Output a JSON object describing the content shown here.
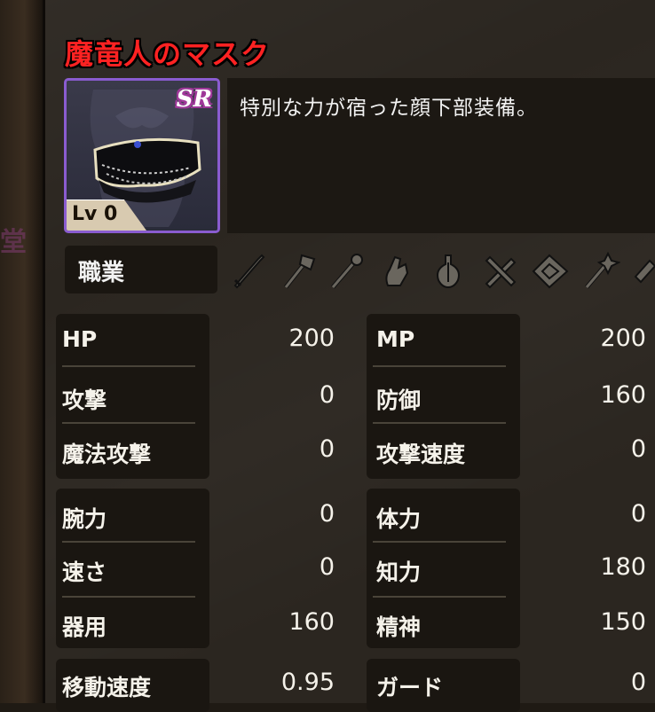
{
  "item": {
    "name": "魔竜人のマスク",
    "rarity": "SR",
    "level": "Lv 0",
    "description": "特別な力が宿った顔下部装備。"
  },
  "job": {
    "label": "職業",
    "icons": [
      "sword-icon",
      "axe-icon",
      "staff-icon",
      "fist-icon",
      "flask-icon",
      "crossed-daggers-icon",
      "book-icon",
      "wand-icon",
      "partial-icon"
    ]
  },
  "stats": {
    "group1": {
      "left": [
        {
          "label": "HP",
          "value": "200"
        },
        {
          "label": "攻撃",
          "value": "0"
        },
        {
          "label": "魔法攻撃",
          "value": "0"
        }
      ],
      "right": [
        {
          "label": "MP",
          "value": "200"
        },
        {
          "label": "防御",
          "value": "160"
        },
        {
          "label": "攻撃速度",
          "value": "0"
        }
      ]
    },
    "group2": {
      "left": [
        {
          "label": "腕力",
          "value": "0"
        },
        {
          "label": "速さ",
          "value": "0"
        },
        {
          "label": "器用",
          "value": "160"
        }
      ],
      "right": [
        {
          "label": "体力",
          "value": "0"
        },
        {
          "label": "知力",
          "value": "180"
        },
        {
          "label": "精神",
          "value": "150"
        }
      ]
    },
    "group3": {
      "left": [
        {
          "label": "移動速度",
          "value": "0.95"
        }
      ],
      "right": [
        {
          "label": "ガード",
          "value": "0"
        }
      ]
    }
  },
  "colors": {
    "title": "#ff2222",
    "rarity_frame": "#8a5cd0",
    "panel": "#2b2620",
    "box": "#1a1611"
  }
}
